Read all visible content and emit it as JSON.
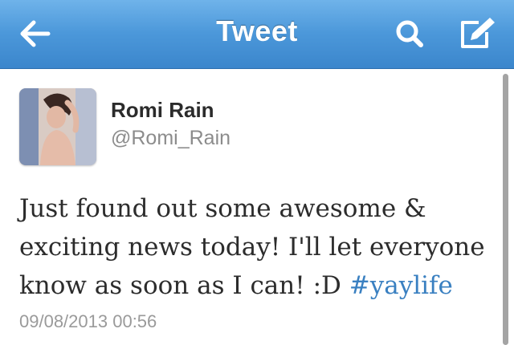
{
  "navbar": {
    "title": "Tweet",
    "back_icon": "back-arrow-icon",
    "search_icon": "search-icon",
    "compose_icon": "compose-icon",
    "background": "#4c98da"
  },
  "tweet": {
    "author_name": "Romi Rain",
    "author_handle": "@Romi_Rain",
    "text_main": "Just found out some awesome & exciting news today! I'll let everyone know as soon as I can! :D",
    "hashtag": "#yaylife",
    "timestamp": "09/08/2013 00:56",
    "hashtag_color": "#3a80c1"
  }
}
